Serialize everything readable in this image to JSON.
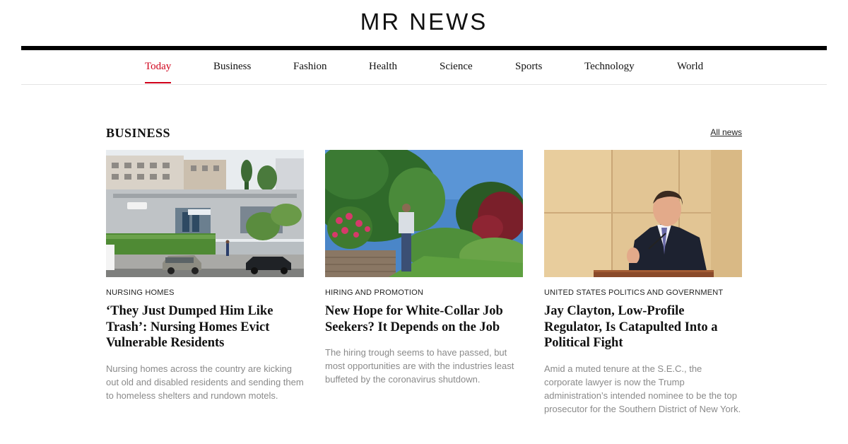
{
  "site": {
    "title": "MR NEWS"
  },
  "nav": {
    "items": [
      {
        "label": "Today",
        "active": true
      },
      {
        "label": "Business",
        "active": false
      },
      {
        "label": "Fashion",
        "active": false
      },
      {
        "label": "Health",
        "active": false
      },
      {
        "label": "Science",
        "active": false
      },
      {
        "label": "Sports",
        "active": false
      },
      {
        "label": "Technology",
        "active": false
      },
      {
        "label": "World",
        "active": false
      }
    ]
  },
  "section": {
    "title": "BUSINESS",
    "all_news_label": "All news"
  },
  "articles": [
    {
      "tag": "NURSING HOMES",
      "title": "‘They Just Dumped Him Like Trash’: Nursing Homes Evict Vulnerable Residents",
      "summary": "Nursing homes across the country are kicking out old and disabled residents and sending them to homeless shelters and rundown motels."
    },
    {
      "tag": "HIRING AND PROMOTION",
      "title": "New Hope for White-Collar Job Seekers? It Depends on the Job",
      "summary": "The hiring trough seems to have passed, but most opportunities are with the industries least buffeted by the coronavirus shutdown."
    },
    {
      "tag": "UNITED STATES POLITICS AND GOVERNMENT",
      "title": "Jay Clayton, Low-Profile Regulator, Is Catapulted Into a Political Fight",
      "summary": "Amid a muted tenure at the S.E.C., the corporate lawyer is now the Trump administration’s intended nominee to be the top prosecutor for the Southern District of New York."
    }
  ],
  "colors": {
    "accent": "#d0021b",
    "summary_text": "#8a8a8a",
    "rule": "#000000"
  }
}
